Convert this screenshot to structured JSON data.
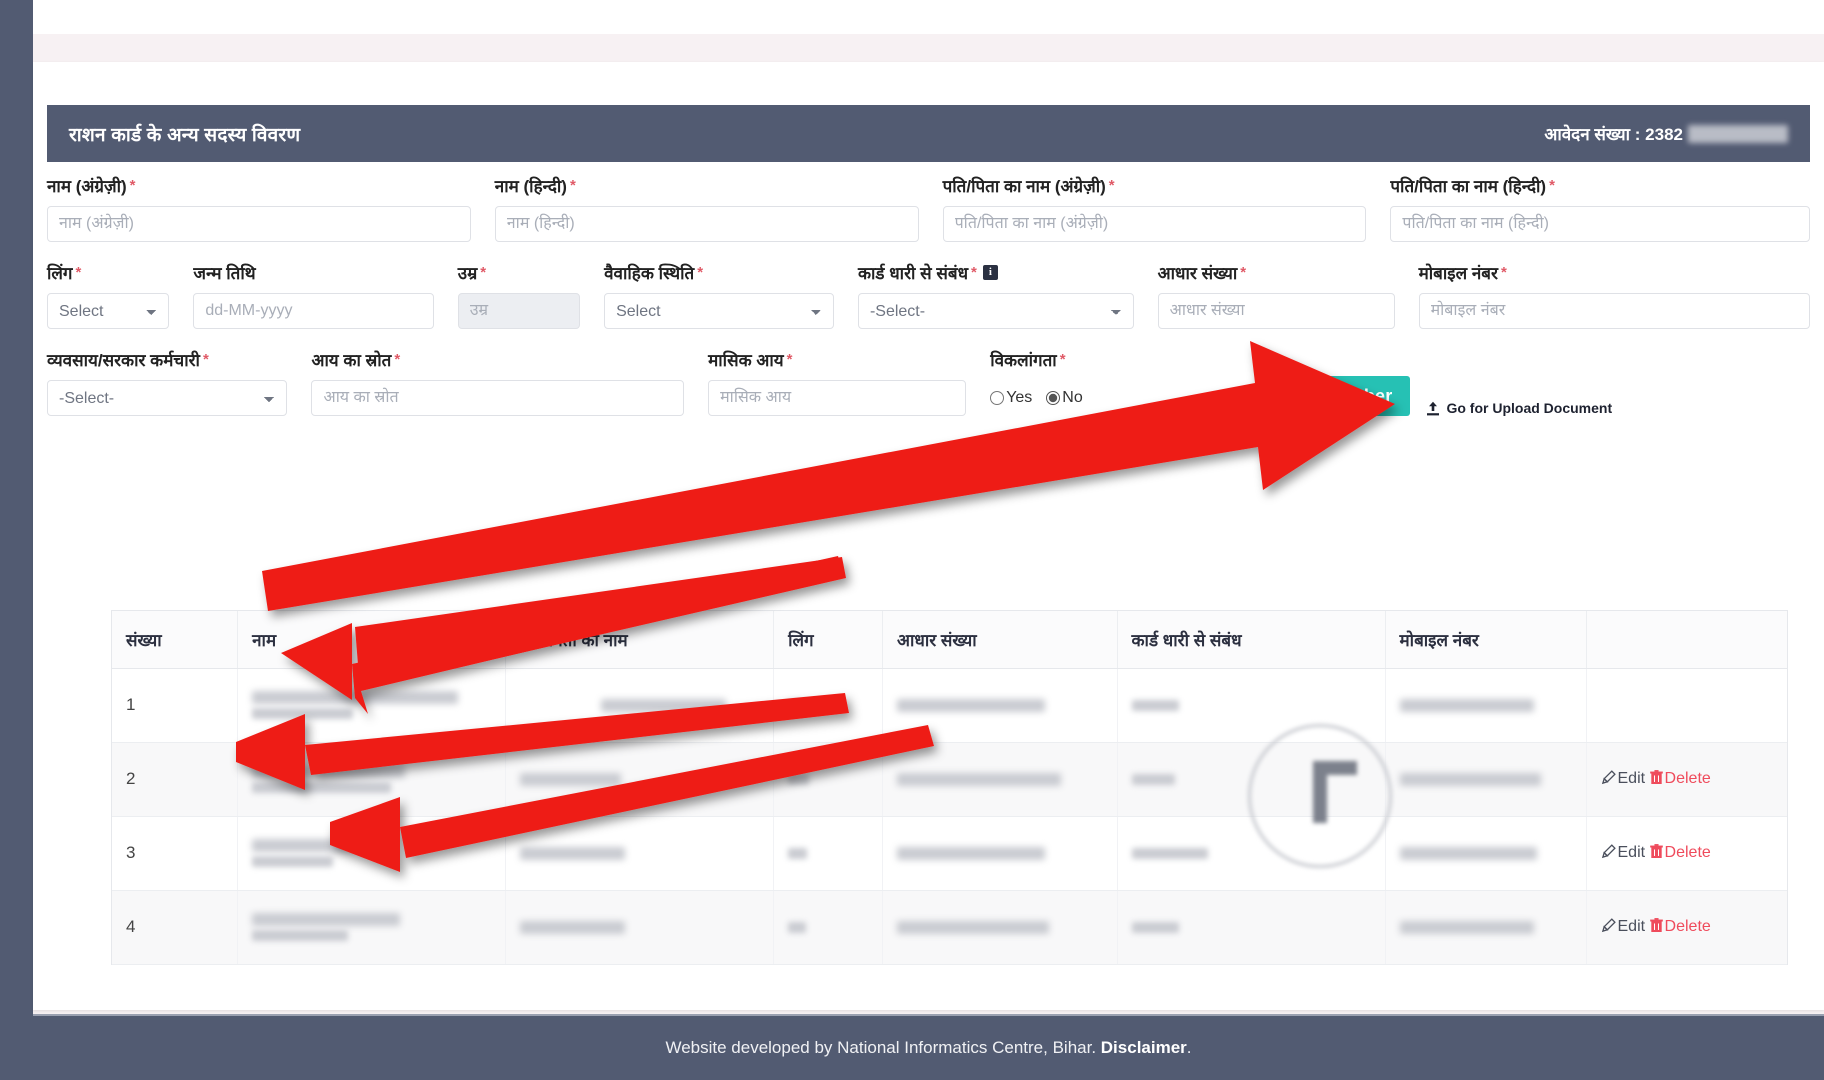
{
  "header": {
    "title": "राशन कार्ड के अन्य सदस्य विवरण",
    "application_label": "आवेदन संख्या : 2382"
  },
  "form": {
    "row1": [
      {
        "label": "नाम (अंग्रेज़ी)",
        "required": true,
        "placeholder": "नाम (अंग्रेज़ी)",
        "type": "text",
        "value": ""
      },
      {
        "label": "नाम (हिन्दी)",
        "required": true,
        "placeholder": "नाम (हिन्दी)",
        "type": "text",
        "value": ""
      },
      {
        "label": "पति/पिता का नाम (अंग्रेज़ी)",
        "required": true,
        "placeholder": "पति/पिता का नाम (अंग्रेज़ी)",
        "type": "text",
        "value": ""
      },
      {
        "label": "पति/पिता का नाम (हिन्दी)",
        "required": true,
        "placeholder": "पति/पिता का नाम (हिन्दी)",
        "type": "text",
        "value": ""
      }
    ],
    "row2": [
      {
        "label": "लिंग",
        "required": true,
        "type": "select",
        "selected": "Select"
      },
      {
        "label": "जन्म तिथि",
        "required": false,
        "placeholder": "dd-MM-yyyy",
        "type": "text",
        "value": ""
      },
      {
        "label": "उम्र",
        "required": true,
        "placeholder": "उम्र",
        "type": "text",
        "value": "",
        "readonly": true
      },
      {
        "label": "वैवाहिक स्थिति",
        "required": true,
        "type": "select",
        "selected": "Select"
      },
      {
        "label": "कार्ड धारी से संबंध",
        "required": true,
        "type": "select",
        "selected": "-Select-",
        "info_icon": "info-icon"
      },
      {
        "label": "आधार संख्या",
        "required": true,
        "placeholder": "आधार संख्या",
        "type": "text",
        "value": ""
      },
      {
        "label": "मोबाइल नंबर",
        "required": true,
        "placeholder": "मोबाइल नंबर",
        "type": "text",
        "value": ""
      }
    ],
    "row3": [
      {
        "label": "व्यवसाय/सरकार कर्मचारी",
        "required": true,
        "type": "select",
        "selected": "-Select-"
      },
      {
        "label": "आय का स्रोत",
        "required": true,
        "placeholder": "आय का स्रोत",
        "type": "text",
        "value": ""
      },
      {
        "label": "मासिक आय",
        "required": true,
        "placeholder": "मासिक आय",
        "type": "text",
        "value": ""
      },
      {
        "label": "विकलांगता",
        "required": true,
        "type": "radio"
      }
    ],
    "disability_options": [
      {
        "label": "Yes",
        "checked": false
      },
      {
        "label": "No",
        "checked": true
      }
    ],
    "add_member_button": "Add Member",
    "upload_link": "Go for Upload Document",
    "upload_icon": "upload-icon"
  },
  "table": {
    "columns": [
      "संख्या",
      "नाम",
      "पति/पिता का नाम",
      "लिंग",
      "आधार संख्या",
      "कार्ड धारी से संबंध",
      "मोबाइल नंबर",
      ""
    ],
    "rows": [
      {
        "num": "1",
        "redacted": true,
        "has_actions": false
      },
      {
        "num": "2",
        "redacted": true,
        "has_actions": true
      },
      {
        "num": "3",
        "redacted": true,
        "has_actions": true
      },
      {
        "num": "4",
        "redacted": true,
        "has_actions": true
      }
    ],
    "edit_label": "Edit",
    "delete_label": "Delete",
    "edit_icon": "pencil-icon",
    "delete_icon": "trash-icon"
  },
  "footer": {
    "text": "Website developed by National Informatics Centre, Bihar.",
    "link": "Disclaimer",
    "suffix": "."
  },
  "annotations": {
    "arrow_color": "#ee1c18",
    "arrow_count": 4,
    "description": "Red annotation arrows pointing to Add Member button and name column rows"
  },
  "colors": {
    "header_bar": "#525b72",
    "accent_button": "#26c1b4",
    "required_star": "#e05a67",
    "delete_red": "#ef4b5c",
    "page_bg": "#f7f1f3"
  }
}
